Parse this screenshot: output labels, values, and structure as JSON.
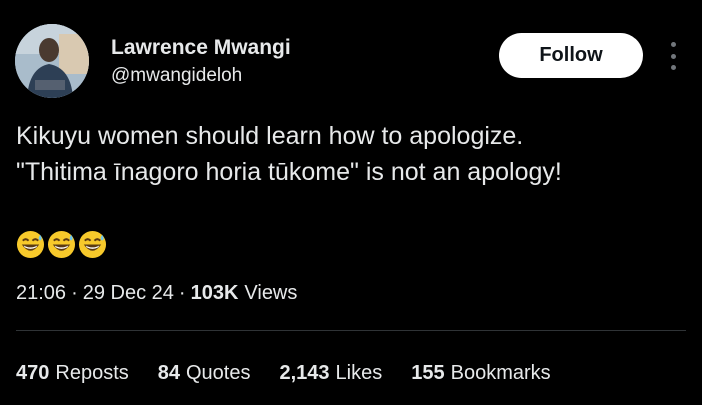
{
  "author": {
    "name": "Lawrence Mwangi",
    "handle": "@mwangideloh"
  },
  "follow_label": "Follow",
  "post": {
    "lines": [
      "Kikuyu women should learn how to apologize.",
      "\"Thitima īnagoro horia tūkome\" is not an apology!"
    ],
    "emojis": [
      "grinning-face-with-sweat",
      "grinning-face-with-sweat",
      "grinning-face-with-sweat"
    ]
  },
  "meta": {
    "time": "21:06",
    "separator": "·",
    "date": "29 Dec 24",
    "views_count": "103K",
    "views_label": "Views"
  },
  "stats": [
    {
      "count": "470",
      "label": "Reposts"
    },
    {
      "count": "84",
      "label": "Quotes"
    },
    {
      "count": "2,143",
      "label": "Likes"
    },
    {
      "count": "155",
      "label": "Bookmarks"
    }
  ],
  "colors": {
    "background": "#000000",
    "text": "#e7e9ea",
    "secondary": "#71767b",
    "divider": "#2f3336",
    "follow_bg": "#ffffff"
  }
}
